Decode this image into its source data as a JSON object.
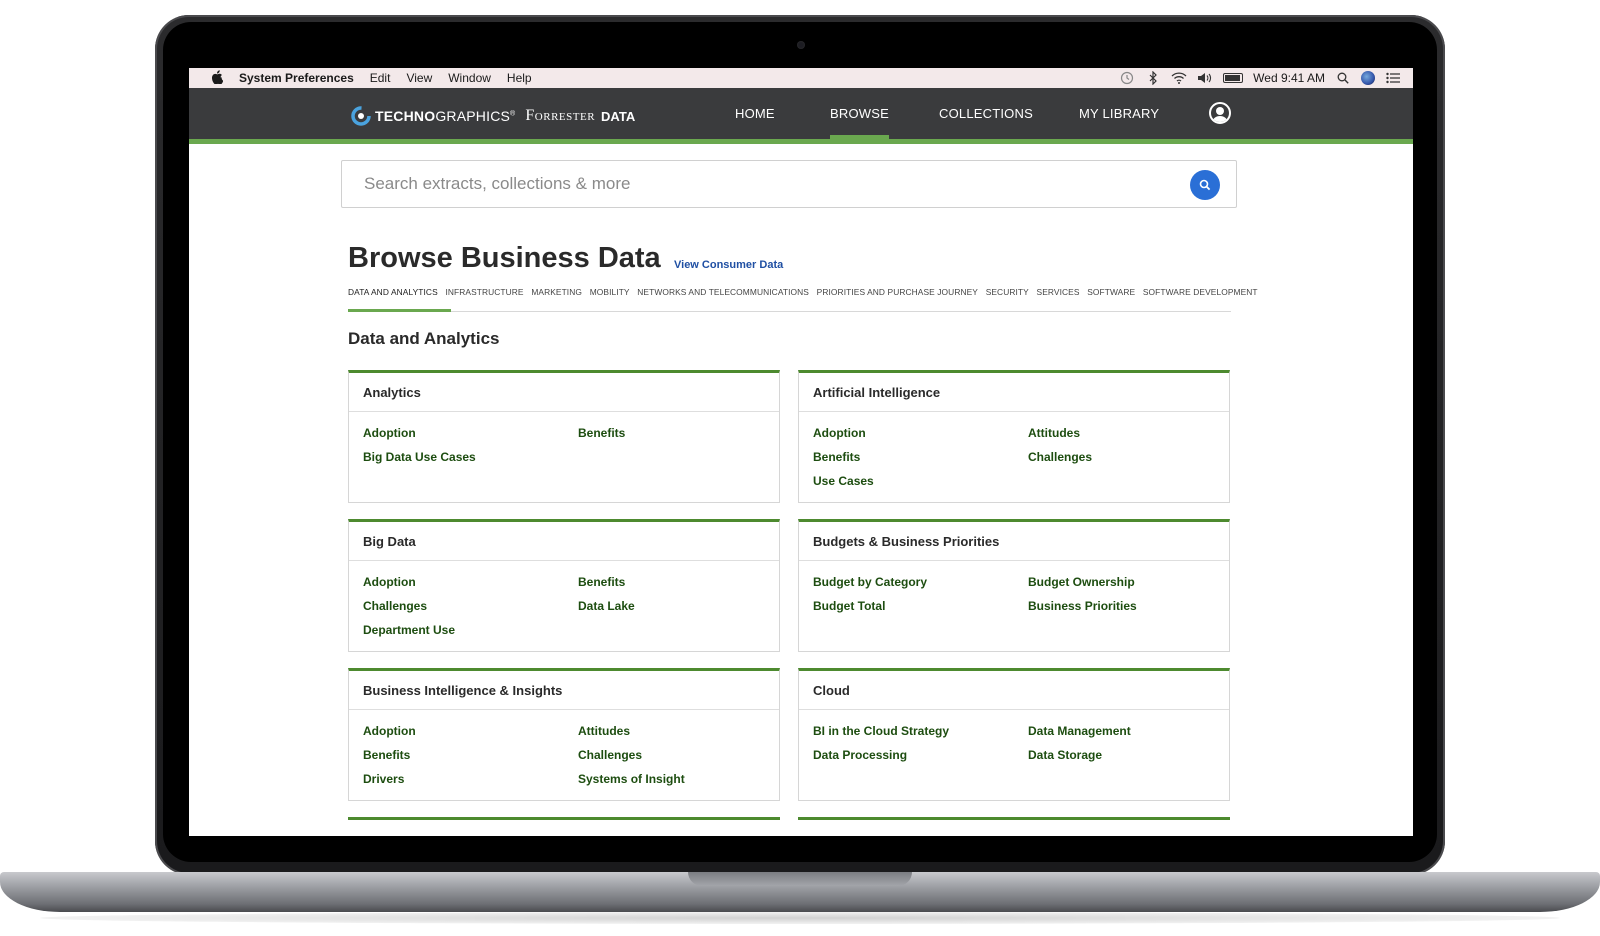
{
  "menubar": {
    "apple": "",
    "app_name": "System Preferences",
    "items": [
      "Edit",
      "View",
      "Window",
      "Help"
    ],
    "clock": "Wed 9:41 AM"
  },
  "header": {
    "brand_tg_bold": "TECHNO",
    "brand_tg_rest": "GRAPHICS",
    "brand_reg": "®",
    "brand_forrester": "Forrester",
    "brand_data": "DATA",
    "nav": {
      "home": "HOME",
      "browse": "BROWSE",
      "collections": "COLLECTIONS",
      "library": "MY LIBRARY"
    },
    "active_nav": "BROWSE"
  },
  "search": {
    "placeholder": "Search extracts, collections & more"
  },
  "page": {
    "title": "Browse Business Data",
    "consumer_link": "View Consumer Data",
    "section_title": "Data and Analytics"
  },
  "tabs": [
    "DATA AND ANALYTICS",
    "INFRASTRUCTURE",
    "MARKETING",
    "MOBILITY",
    "NETWORKS AND TELECOMMUNICATIONS",
    "PRIORITIES AND PURCHASE JOURNEY",
    "SECURITY",
    "SERVICES",
    "SOFTWARE",
    "SOFTWARE DEVELOPMENT"
  ],
  "cards": [
    {
      "title": "Analytics",
      "links": [
        "Adoption",
        "Benefits",
        "Big Data Use Cases"
      ]
    },
    {
      "title": "Artificial Intelligence",
      "links": [
        "Adoption",
        "Attitudes",
        "Benefits",
        "Challenges",
        "Use Cases"
      ]
    },
    {
      "title": "Big Data",
      "links": [
        "Adoption",
        "Benefits",
        "Challenges",
        "Data Lake",
        "Department Use"
      ]
    },
    {
      "title": "Budgets & Business Priorities",
      "links": [
        "Budget by Category",
        "Budget Ownership",
        "Budget Total",
        "Business Priorities"
      ]
    },
    {
      "title": "Business Intelligence & Insights",
      "links": [
        "Adoption",
        "Attitudes",
        "Benefits",
        "Challenges",
        "Drivers",
        "Systems of Insight"
      ]
    },
    {
      "title": "Cloud",
      "links": [
        "BI in the Cloud Strategy",
        "Data Management",
        "Data Processing",
        "Data Storage"
      ]
    }
  ],
  "colors": {
    "header_bg": "#3a3b3d",
    "accent_green": "#6aa84f",
    "card_border_green": "#4d8a2f",
    "link_green": "#1d4d10",
    "search_blue": "#2a6fd6",
    "consumer_link_blue": "#1f4fa3"
  }
}
